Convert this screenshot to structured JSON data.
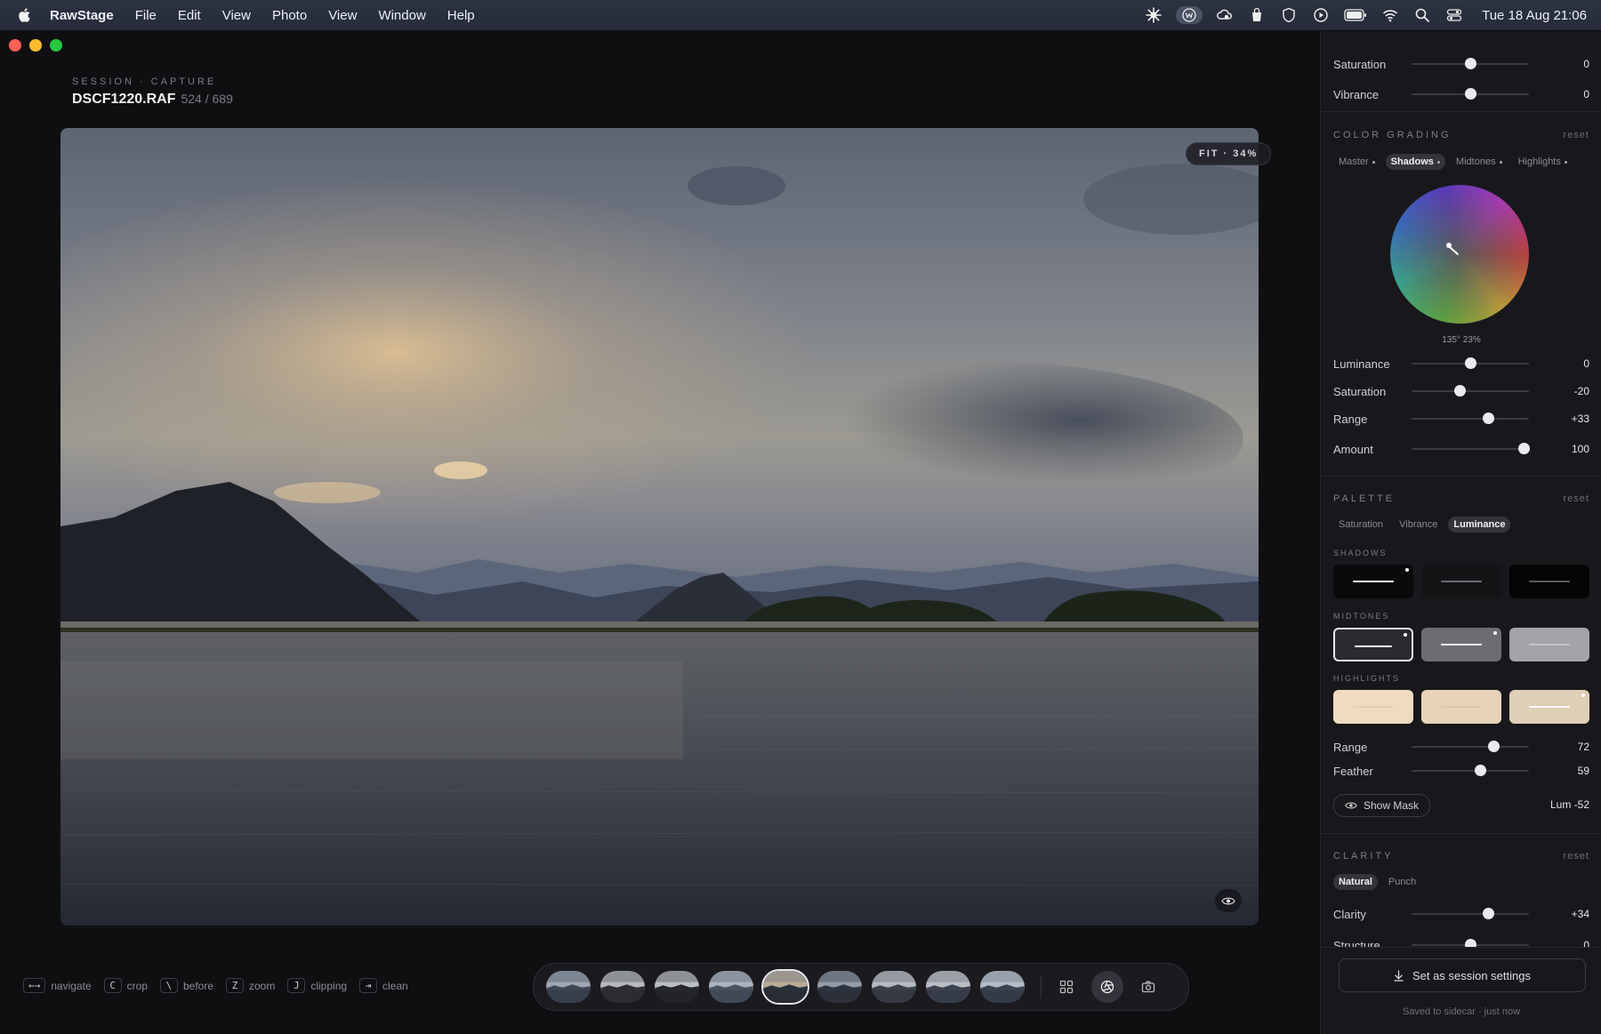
{
  "menubar": {
    "app_name": "RawStage",
    "menus": [
      "File",
      "Edit",
      "View",
      "Photo",
      "View",
      "Window",
      "Help"
    ],
    "status_icons": [
      "sun-icon",
      "circle-w-icon",
      "cloud-sync-icon",
      "bag-icon",
      "shield-icon",
      "play-icon",
      "battery-icon",
      "wifi-icon",
      "search-icon",
      "control-center-icon"
    ],
    "clock": "Tue 18 Aug  21:06"
  },
  "session": {
    "label": "SESSION · CAPTURE",
    "file_name": "DSCF1220.RAF",
    "file_count": "524 / 689"
  },
  "viewer": {
    "zoom_label": "FIT · 34%"
  },
  "shortcuts": [
    {
      "key": "←→",
      "label": "navigate"
    },
    {
      "key": "C",
      "label": "crop"
    },
    {
      "key": "\\",
      "label": "before"
    },
    {
      "key": "Z",
      "label": "zoom"
    },
    {
      "key": "J",
      "label": "clipping"
    },
    {
      "key": "⇥",
      "label": "clean"
    }
  ],
  "filmstrip": {
    "thumb_count": 9,
    "active_index": 4
  },
  "panel": {
    "top_rows": [
      {
        "label": "Saturation",
        "value": "0",
        "pos": 0.5
      },
      {
        "label": "Vibrance",
        "value": "0",
        "pos": 0.5
      }
    ],
    "color_grading": {
      "title": "COLOR GRADING",
      "reset": "reset",
      "tabs": [
        "Master",
        "Shadows",
        "Midtones",
        "Highlights"
      ],
      "active_tab": 1,
      "wheel_readout": "135° 23%",
      "rows": [
        {
          "label": "Luminance",
          "value": "0",
          "pos": 0.5
        },
        {
          "label": "Saturation",
          "value": "-20",
          "pos": 0.41
        },
        {
          "label": "Range",
          "value": "+33",
          "pos": 0.655
        },
        {
          "label": "Amount",
          "value": "100",
          "pos": 0.955
        }
      ]
    },
    "palette": {
      "title": "PALETTE",
      "reset": "reset",
      "tabs": [
        "Saturation",
        "Vibrance",
        "Luminance"
      ],
      "active_tab": 2,
      "groups": [
        {
          "label": "SHADOWS",
          "colors": [
            "#0a0a0c",
            "#141417",
            "#050506"
          ],
          "line": [
            "#ffffff",
            "#6a6a72",
            "#5a5a62"
          ]
        },
        {
          "label": "MIDTONES",
          "colors": [
            "#2a2b30",
            "#6c6d73",
            "#a3a4a8"
          ],
          "line": [
            "#ffffff",
            "#ffffff",
            "#c2c3c7"
          ]
        },
        {
          "label": "HIGHLIGHTS",
          "colors": [
            "#efdcbf",
            "#e7d4b8",
            "#dfcfb6"
          ],
          "line": [
            "#e2cfb2",
            "#dac7ab",
            "#ffffff"
          ]
        }
      ],
      "rows": [
        {
          "label": "Range",
          "value": "72",
          "pos": 0.7
        },
        {
          "label": "Feather",
          "value": "59",
          "pos": 0.58
        }
      ],
      "mask_button": "Show Mask",
      "mask_readout": "Lum -52"
    },
    "clarity": {
      "title": "CLARITY",
      "reset": "reset",
      "tabs": [
        "Natural",
        "Punch"
      ],
      "active_tab": 0,
      "rows": [
        {
          "label": "Clarity",
          "value": "+34",
          "pos": 0.655
        },
        {
          "label": "Structure",
          "value": "0",
          "pos": 0.5
        }
      ]
    },
    "footer": {
      "button": "Set as session settings",
      "note": "Saved to sidecar · just now"
    }
  }
}
